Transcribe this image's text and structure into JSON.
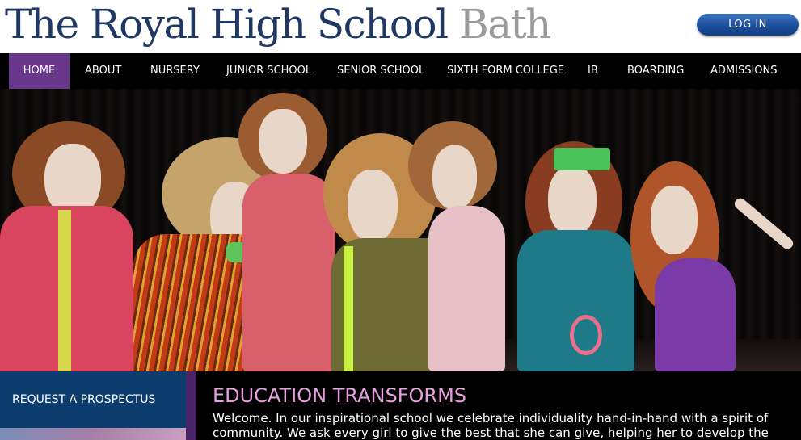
{
  "header": {
    "logo_main": "The Royal High School",
    "logo_city": "Bath",
    "login_label": "LOG IN"
  },
  "nav": {
    "items": [
      {
        "label": "HOME",
        "active": true
      },
      {
        "label": "ABOUT"
      },
      {
        "label": "NURSERY"
      },
      {
        "label": "JUNIOR SCHOOL"
      },
      {
        "label": "SENIOR SCHOOL"
      },
      {
        "label": "SIXTH FORM COLLEGE"
      },
      {
        "label": "IB"
      },
      {
        "label": "BOARDING"
      },
      {
        "label": "ADMISSIONS"
      }
    ]
  },
  "sidebar": {
    "prospectus_label": "REQUEST A PROSPECTUS"
  },
  "content": {
    "title": "EDUCATION TRANSFORMS",
    "body": "Welcome. In our inspirational school we celebrate individuality hand-in-hand with a spirit of community. We ask every girl to give the best that she can give, helping her to develop the"
  },
  "colors": {
    "brand_navy": "#1f3864",
    "nav_active": "#68378c",
    "title_pink": "#e8a0e0"
  }
}
